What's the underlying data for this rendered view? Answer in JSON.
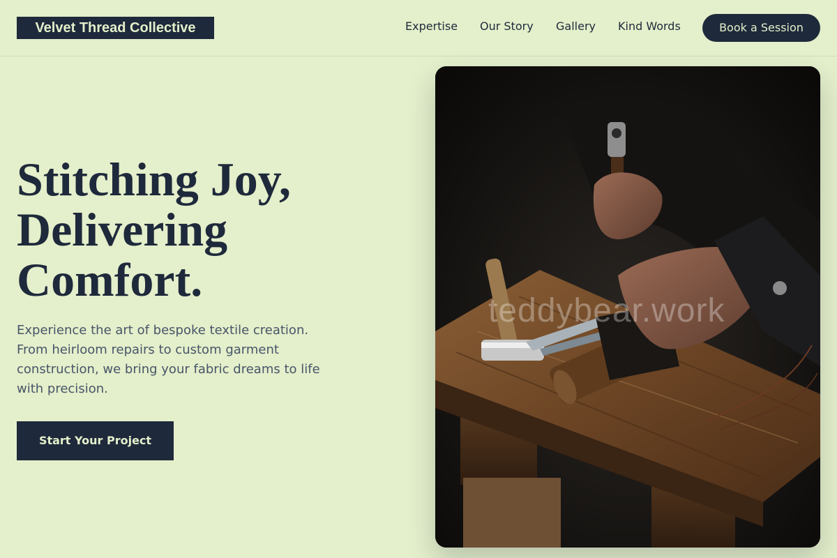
{
  "brand": {
    "name": "Velvet Thread Collective"
  },
  "nav": {
    "items": [
      "Expertise",
      "Our Story",
      "Gallery",
      "Kind Words"
    ],
    "cta_label": "Book a Session"
  },
  "hero": {
    "headline_lines": [
      "Stitching Joy,",
      "Delivering",
      "Comfort."
    ],
    "description": "Experience the art of bespoke textile creation. From heirloom repairs to custom garment construction, we bring your fabric dreams to life with precision.",
    "cta_label": "Start Your Project"
  },
  "image": {
    "subject": "craftsman-hands-with-hammer-and-tools-on-wooden-bench",
    "watermark": "teddybear.work"
  },
  "colors": {
    "background": "#e4efcb",
    "primary": "#1e293b",
    "body_text": "#475569",
    "on_primary": "#e4efcb"
  }
}
